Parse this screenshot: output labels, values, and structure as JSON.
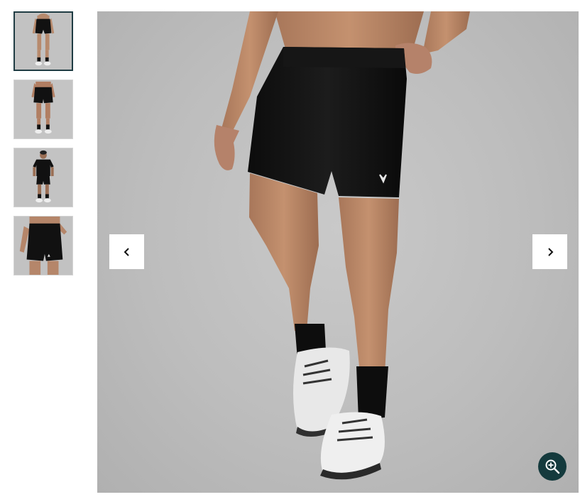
{
  "gallery": {
    "thumbnails": [
      {
        "icon": "full-body-front-icon",
        "active": true
      },
      {
        "icon": "full-body-back-icon",
        "active": false
      },
      {
        "icon": "full-body-tshirt-icon",
        "active": false
      },
      {
        "icon": "shorts-closeup-icon",
        "active": false
      }
    ],
    "main_image": {
      "subject": "model wearing black running shorts, black socks and white running shoes"
    },
    "prev_button": {
      "icon": "chevron-left-icon"
    },
    "next_button": {
      "icon": "chevron-right-icon"
    },
    "zoom_button": {
      "icon": "zoom-in-icon"
    },
    "colors": {
      "active_thumb_border": "#1f3c43",
      "zoom_button_bg": "#143a3d",
      "background": "#bdbdbd"
    }
  }
}
